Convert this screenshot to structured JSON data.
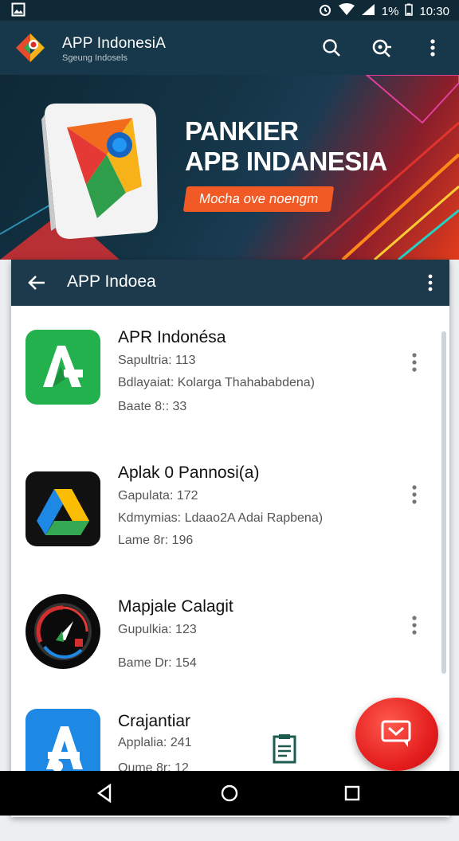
{
  "status": {
    "battery": "1%",
    "time": "10:30"
  },
  "app": {
    "title": "APP IndonesiA",
    "subtitle": "Sgeung Indosels"
  },
  "hero": {
    "line1": "PANKIER",
    "line2": "APB INDANESIA",
    "tagline": "Mocha ove noengm"
  },
  "card": {
    "title": "APP Indoea"
  },
  "apps": [
    {
      "name": "APR Indonésa",
      "line1": "Sapultria: 113",
      "line2": "Bdlayaiat: Kolarga Thahababdena)",
      "line3": "Baate 8:: 33",
      "icon": "green-app-icon"
    },
    {
      "name": "Aplak 0 Pannosi(a)",
      "line1": "Gapulata: 172",
      "line2": "Kdmymias: Ldaao2A Adai Rapbena)",
      "line3": "Lame 8r: 196",
      "icon": "drive-triangle-icon"
    },
    {
      "name": "Mapjale Calagit",
      "line1": "Gupulkia: 123",
      "line2": "",
      "line3": "Bame Dr: 154",
      "icon": "circular-gauge-icon"
    },
    {
      "name": "Crajantiar",
      "line1": "Applalia: 241",
      "line2": "",
      "line3": "Oume 8r: 12",
      "icon": "blue-a-icon"
    }
  ],
  "colors": {
    "appbar": "#16384a",
    "accent": "#f15a24",
    "fab": "#e31c1c"
  }
}
